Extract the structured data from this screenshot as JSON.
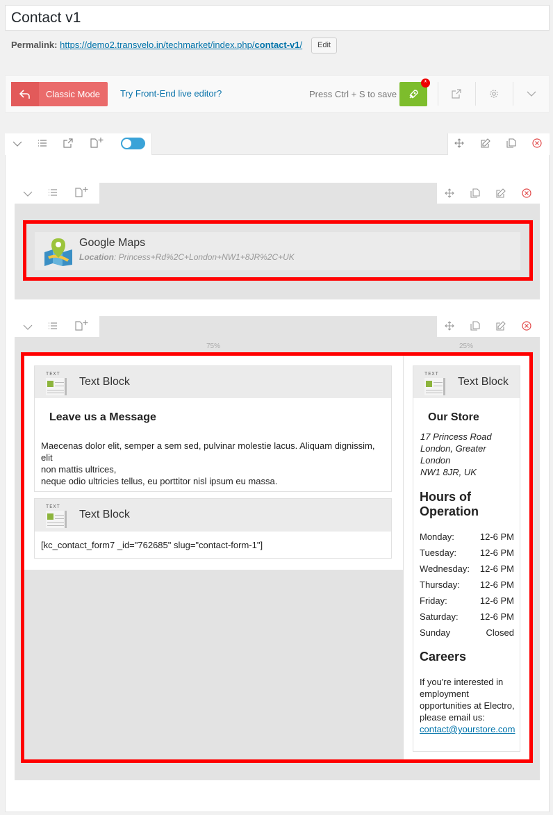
{
  "page": {
    "title": "Contact v1",
    "permalink_label": "Permalink:",
    "permalink_base": "https://demo2.transvelo.in/techmarket/index.php/",
    "permalink_slug": "contact-v1",
    "permalink_end": "/",
    "edit_label": "Edit"
  },
  "toolbar": {
    "classic_mode_label": "Classic Mode",
    "frontend_link": "Try Front-End live editor?",
    "save_hint": "Press Ctrl + S to save",
    "badge": "*"
  },
  "rows": {
    "column_widths": [
      "75%",
      "25%"
    ]
  },
  "google_maps": {
    "title": "Google Maps",
    "location_label": "Location",
    "location_value": ": Princess+Rd%2C+London+NW1+8JR%2C+UK"
  },
  "text_block_label": "Text Block",
  "text_icon_label": "TEXT",
  "message_block": {
    "heading": "Leave us a Message",
    "line1": "Maecenas dolor elit, semper a sem sed, pulvinar molestie lacus. Aliquam dignissim, elit",
    "line2": "non mattis ultrices,",
    "line3": "neque odio ultricies tellus, eu porttitor nisl ipsum eu massa."
  },
  "form_block": {
    "shortcode": "[kc_contact_form7 _id=\"762685\" slug=\"contact-form-1\"]"
  },
  "store_block": {
    "heading": "Our Store",
    "address": [
      "17 Princess Road",
      "London, Greater",
      "London",
      "NW1 8JR, UK"
    ],
    "hours_heading_1": "Hours of",
    "hours_heading_2": "Operation",
    "hours": [
      {
        "day": "Monday:",
        "time": "12-6 PM"
      },
      {
        "day": "Tuesday:",
        "time": "12-6 PM"
      },
      {
        "day": "Wednesday:",
        "time": "12-6 PM"
      },
      {
        "day": "Thursday:",
        "time": "12-6 PM"
      },
      {
        "day": "Friday:",
        "time": "12-6 PM"
      },
      {
        "day": "Saturday:",
        "time": "12-6 PM"
      },
      {
        "day": "Sunday",
        "time": "Closed"
      }
    ],
    "careers_heading": "Careers",
    "careers_text": [
      "If you're interested in",
      "employment",
      "opportunities at Electro,",
      "please email us:"
    ],
    "email": "contact@yourstore.com"
  },
  "colors": {
    "accent_blue": "#0073aa",
    "classic_red": "#ea6b6b",
    "save_green": "#7dbd2c",
    "highlight_red": "#ff0000",
    "toggle_blue": "#3aa3d8"
  }
}
